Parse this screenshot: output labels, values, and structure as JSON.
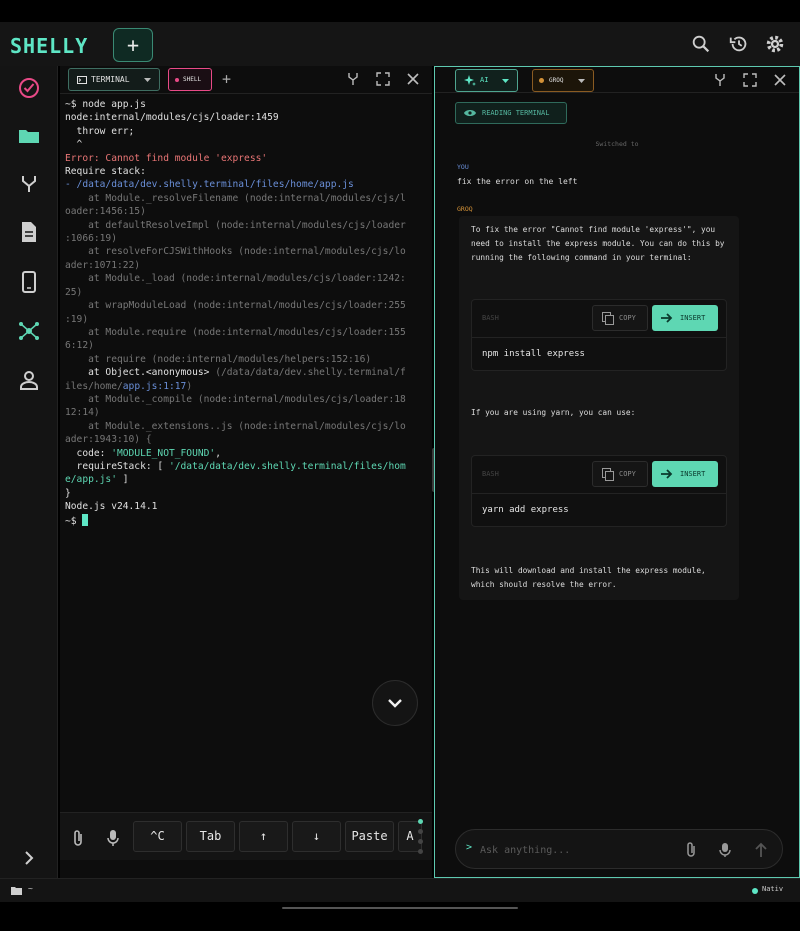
{
  "app": {
    "logo": "SHELLY",
    "new_button": "+"
  },
  "toolbar": {
    "icons": [
      "search-icon",
      "history-icon",
      "gear-icon"
    ]
  },
  "sidebar": {
    "icons": [
      "check-circle-icon",
      "folder-icon",
      "git-branch-icon",
      "document-icon",
      "phone-icon",
      "network-icon",
      "person-icon",
      "chevron-right-icon"
    ]
  },
  "terminal": {
    "tab_label": "TERMINAL",
    "shell_label": "SHELL",
    "add_tab": "+",
    "lines": {
      "l1": "~$ node app.js",
      "l2": "node:internal/modules/cjs/loader:1459",
      "l3": "  throw err;",
      "l4": "  ^",
      "l5": "",
      "l6": "Error: Cannot find module 'express'",
      "l7": "Require stack:",
      "l8": "- /data/data/dev.shelly.terminal/files/home/app.js",
      "l9": "    at Module._resolveFilename (node:internal/modules/cjs/l",
      "l10": "oader:1456:15)",
      "l11": "    at defaultResolveImpl (node:internal/modules/cjs/loader",
      "l12": ":1066:19)",
      "l13": "    at resolveForCJSWithHooks (node:internal/modules/cjs/lo",
      "l14": "ader:1071:22)",
      "l15": "    at Module._load (node:internal/modules/cjs/loader:1242:",
      "l16": "25)",
      "l17": "    at wrapModuleLoad (node:internal/modules/cjs/loader:255",
      "l18": ":19)",
      "l19": "    at Module.require (node:internal/modules/cjs/loader:155",
      "l20": "6:12)",
      "l21": "    at require (node:internal/modules/helpers:152:16)",
      "l22a": "    at Object.<anonymous> ",
      "l22b": "(/data/data/dev.shelly.terminal/f",
      "l23a": "iles/home/",
      "l23b": "app.js:1:17",
      "l23c": ")",
      "l24": "    at Module._compile (node:internal/modules/cjs/loader:18",
      "l25": "12:14)",
      "l26": "    at Module._extensions..js (node:internal/modules/cjs/lo",
      "l27": "ader:1943:10) {",
      "l28a": "  code: ",
      "l28b": "'MODULE_NOT_FOUND'",
      "l28c": ",",
      "l29a": "  requireStack: [ ",
      "l29b": "'/data/data/dev.shelly.terminal/files/hom",
      "l30a": "e/app.js'",
      "l30b": " ]",
      "l31": "}",
      "l32": "",
      "l33": "Node.js v24.14.1",
      "l34": "~$ "
    },
    "keys": [
      "^C",
      "Tab",
      "↑",
      "↓",
      "Paste",
      "A"
    ]
  },
  "ai": {
    "tab_label": "AI",
    "provider_label": "GROQ",
    "reading_label": "READING TERMINAL",
    "switched_text": "Switched to",
    "you_label": "YOU",
    "user_message": "fix the error on the left",
    "assistant_label": "GROQ",
    "response": {
      "p1": "To fix the error \"Cannot find module 'express'\", you\nneed to install the express module. You can do this by\nrunning the following command in your terminal:",
      "p2": "If you are using yarn, you can use:",
      "p3": "This will download and install the express module,\nwhich should resolve the error."
    },
    "code_blocks": [
      {
        "lang": "BASH",
        "copy_label": "COPY",
        "insert_label": "INSERT",
        "code": "npm install express"
      },
      {
        "lang": "BASH",
        "copy_label": "COPY",
        "insert_label": "INSERT",
        "code": "yarn add express"
      }
    ],
    "input_prompt": ">",
    "input_placeholder": "Ask anything..."
  },
  "status": {
    "path": "~",
    "mode": "Nativ"
  },
  "colors": {
    "accent": "#5ee6c5",
    "shell_tab": "#e84a87",
    "groq_tab": "#d49238",
    "error": "#e87575",
    "link": "#6a8fd8"
  }
}
